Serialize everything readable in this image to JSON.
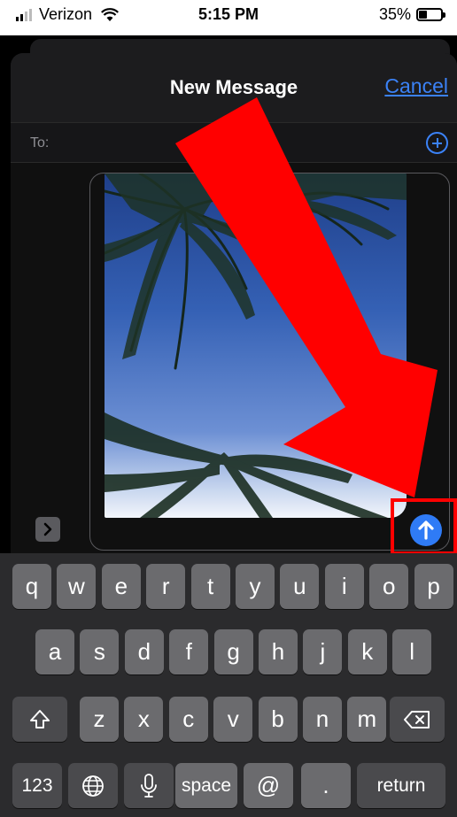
{
  "status_bar": {
    "carrier": "Verizon",
    "time": "5:15 PM",
    "battery_percent": "35%",
    "battery_level": 0.35
  },
  "header": {
    "title": "New Message",
    "cancel_label": "Cancel"
  },
  "recipient": {
    "to_label": "To:"
  },
  "keyboard": {
    "row1": [
      "q",
      "w",
      "e",
      "r",
      "t",
      "y",
      "u",
      "i",
      "o",
      "p"
    ],
    "row2": [
      "a",
      "s",
      "d",
      "f",
      "g",
      "h",
      "j",
      "k",
      "l"
    ],
    "row3": [
      "z",
      "x",
      "c",
      "v",
      "b",
      "n",
      "m"
    ],
    "numbers_label": "123",
    "space_label": "space",
    "at_label": "@",
    "period_label": ".",
    "return_label": "return"
  },
  "colors": {
    "accent": "#3b82f6",
    "send_button": "#2f7bf6",
    "annotation": "#ff0000",
    "key": "#6b6b6e",
    "key_dark": "#4a4a4d"
  },
  "icons": {
    "add_contact": "plus-circle-icon",
    "expand": "chevron-right-icon",
    "send": "arrow-up-icon",
    "shift": "shift-icon",
    "delete": "backspace-icon",
    "globe": "globe-icon",
    "dictation": "microphone-icon"
  }
}
